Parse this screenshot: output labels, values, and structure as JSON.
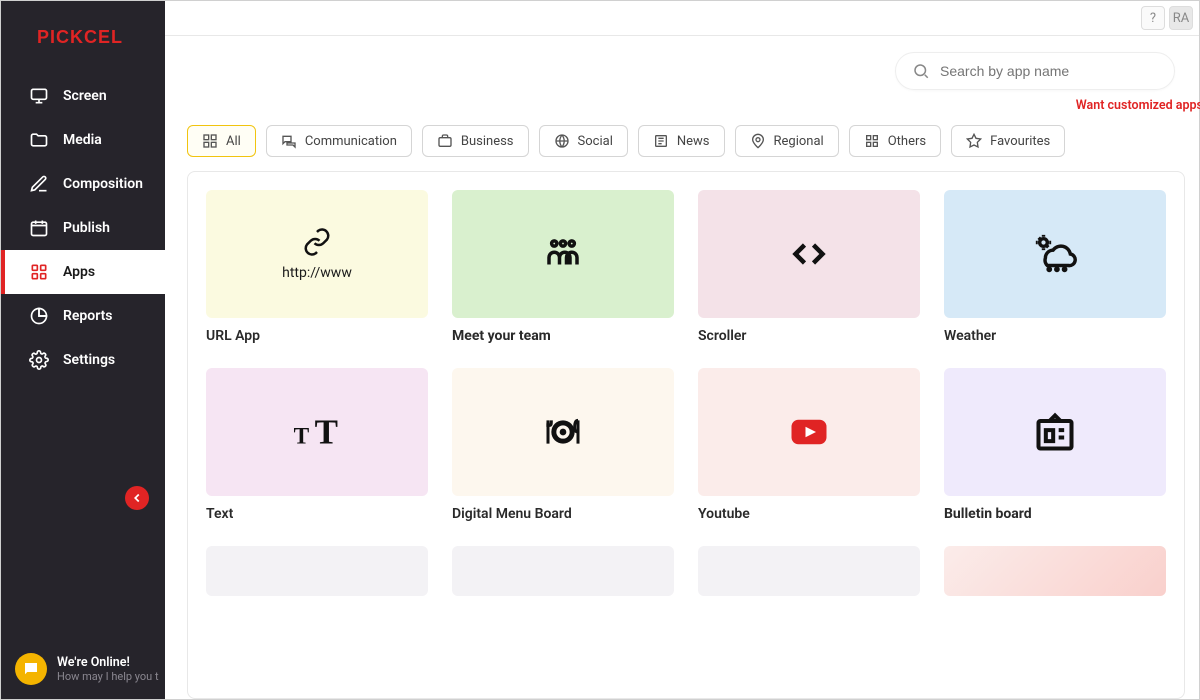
{
  "brand": "PICKCEL",
  "sidebar": {
    "items": [
      {
        "label": "Screen"
      },
      {
        "label": "Media"
      },
      {
        "label": "Composition"
      },
      {
        "label": "Publish"
      },
      {
        "label": "Apps"
      },
      {
        "label": "Reports"
      },
      {
        "label": "Settings"
      }
    ]
  },
  "topbar": {
    "help": "?",
    "avatar": "RA"
  },
  "search": {
    "placeholder": "Search by app name"
  },
  "custom_link": "Want customized apps",
  "filters": [
    {
      "label": "All"
    },
    {
      "label": "Communication"
    },
    {
      "label": "Business"
    },
    {
      "label": "Social"
    },
    {
      "label": "News"
    },
    {
      "label": "Regional"
    },
    {
      "label": "Others"
    },
    {
      "label": "Favourites"
    }
  ],
  "apps": [
    {
      "label": "URL App",
      "sub": "http://www"
    },
    {
      "label": "Meet your team"
    },
    {
      "label": "Scroller"
    },
    {
      "label": "Weather"
    },
    {
      "label": "Text"
    },
    {
      "label": "Digital Menu Board"
    },
    {
      "label": "Youtube"
    },
    {
      "label": "Bulletin board"
    }
  ],
  "chat": {
    "line1": "We're Online!",
    "line2": "How may I help you t"
  }
}
